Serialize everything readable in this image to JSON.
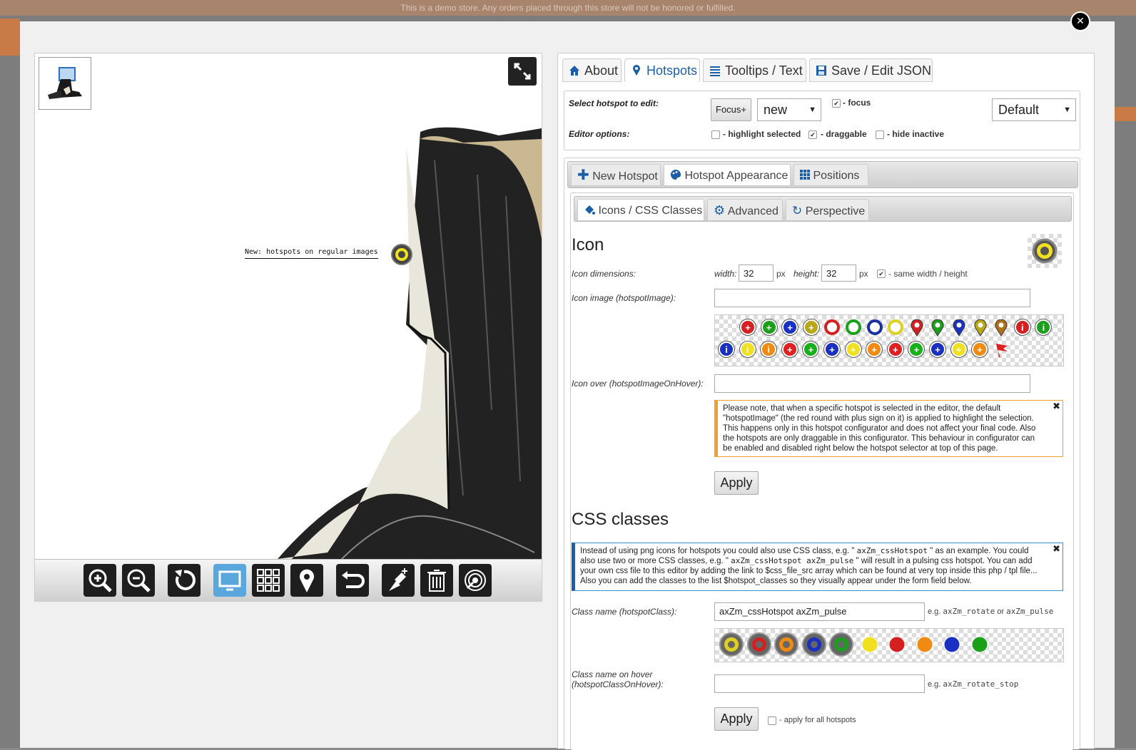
{
  "demo_banner": "This is a demo store. Any orders placed through this store will not be honored or fulfilled.",
  "close_symbol": "✕",
  "viewer": {
    "hotspot_label": "New: hotspots on regular images",
    "toolbar_icons": [
      "zoom-in-icon",
      "zoom-out-icon",
      "reset-icon",
      "fullscreen-screen-icon",
      "gallery-grid-icon",
      "hotspot-pin-icon",
      "undo-icon",
      "add-hotspot-icon",
      "trash-icon",
      "spin-icon"
    ]
  },
  "main_tabs": [
    {
      "label": "About",
      "icon": "home-icon"
    },
    {
      "label": "Hotspots",
      "icon": "map-marker-icon"
    },
    {
      "label": "Tooltips / Text",
      "icon": "list-icon"
    },
    {
      "label": "Save / Edit JSON",
      "icon": "save-icon"
    }
  ],
  "selector": {
    "select_label": "Select hotspot to edit:",
    "focus_button": "Focus+",
    "hotspot_select": "new",
    "focus_checkbox": "- focus",
    "preset_select": "Default",
    "options_label": "Editor options:",
    "highlight_selected": "- highlight selected",
    "draggable": "- draggable",
    "hide_inactive": "- hide inactive"
  },
  "sub_tabs": [
    {
      "label": "New Hotspot",
      "icon": "plus-icon"
    },
    {
      "label": "Hotspot Appearance",
      "icon": "palette-icon"
    },
    {
      "label": "Positions",
      "icon": "grid-icon"
    }
  ],
  "inner_tabs": [
    {
      "label": "Icons / CSS Classes",
      "icon": "paint-bucket-icon"
    },
    {
      "label": "Advanced",
      "icon": "cog-icon"
    },
    {
      "label": "Perspective",
      "icon": "refresh-icon"
    }
  ],
  "icon_section": {
    "heading": "Icon",
    "dimensions_label": "Icon dimensions:",
    "width_label": "width:",
    "width_value": "32",
    "height_label": "height:",
    "height_value": "32",
    "px": "px",
    "same_wh": "- same width / height",
    "image_label": "Icon image (hotspotImage):",
    "image_value": "",
    "over_label": "Icon over (hotspotImageOnHover):",
    "over_value": "",
    "note": "Please note, that when a specific hotspot is selected in the editor, the default \"hotspotImage\" (the red round with plus sign on it) is applied to highlight the selection. This happens only in this hotspot configurator and does not affect your final code. Also the hotspots are only draggable in this configurator. This behaviour in configurator can be enabled and disabled right below the hotspot selector at top of this page.",
    "note_close": "✖",
    "apply": "Apply",
    "icons_row1": [
      {
        "kind": "dot",
        "color": "#d42020",
        "glyph": "+"
      },
      {
        "kind": "dot",
        "color": "#1aa01a",
        "glyph": "+"
      },
      {
        "kind": "dot",
        "color": "#1a30c0",
        "glyph": "+"
      },
      {
        "kind": "dot",
        "color": "#b8a818",
        "glyph": "+"
      },
      {
        "kind": "ring",
        "color": "#d42020"
      },
      {
        "kind": "ring",
        "color": "#1aa01a"
      },
      {
        "kind": "ring",
        "color": "#1a30a0"
      },
      {
        "kind": "ring",
        "color": "#e0d020"
      },
      {
        "kind": "pin",
        "color": "#d42020"
      },
      {
        "kind": "pin",
        "color": "#1aa01a"
      },
      {
        "kind": "pin",
        "color": "#1a30c0"
      },
      {
        "kind": "pin",
        "color": "#b8a818"
      },
      {
        "kind": "pin",
        "color": "#b07018"
      },
      {
        "kind": "dot",
        "color": "#d42020",
        "glyph": "i"
      },
      {
        "kind": "dot",
        "color": "#1aa01a",
        "glyph": "i"
      }
    ],
    "icons_row2": [
      {
        "kind": "dot",
        "color": "#1a30c0",
        "glyph": "i"
      },
      {
        "kind": "dot",
        "color": "#f0e020",
        "glyph": "i"
      },
      {
        "kind": "dot",
        "color": "#f08a10",
        "glyph": "i"
      },
      {
        "kind": "dot",
        "color": "#e02020",
        "glyph": "+"
      },
      {
        "kind": "dot",
        "color": "#18b018",
        "glyph": "+"
      },
      {
        "kind": "dot",
        "color": "#1a30c0",
        "glyph": "+"
      },
      {
        "kind": "dot",
        "color": "#f0e020",
        "glyph": "+"
      },
      {
        "kind": "dot",
        "color": "#f08a10",
        "glyph": "+"
      },
      {
        "kind": "dot",
        "color": "#e02020",
        "glyph": "+"
      },
      {
        "kind": "dot",
        "color": "#18b018",
        "glyph": "+"
      },
      {
        "kind": "dot",
        "color": "#1a30c0",
        "glyph": "+"
      },
      {
        "kind": "dot",
        "color": "#f0e020",
        "glyph": "+"
      },
      {
        "kind": "dot",
        "color": "#f08a10",
        "glyph": "+"
      },
      {
        "kind": "flag",
        "color": "#e02020"
      }
    ]
  },
  "css_section": {
    "heading": "CSS classes",
    "note_parts": [
      "Instead of using png icons for hotspots you could also use CSS class, e.g. \" ",
      "axZm_cssHotspot",
      " \" as an example. You could also use two or more CSS classes, e.g. \" ",
      "axZm_cssHotspot axZm_pulse",
      " \" will result in a pulsing css hotspot. You can add your own css file to this editor by adding the link to $css_file_src array which can be found at very top inside this php / tpl file... Also you can add the classes to the list $hotspot_classes so they visually appear under the form field below."
    ],
    "note_close": "✖",
    "class_label": "Class name (hotspotClass):",
    "class_value": "axZm_cssHotspot axZm_pulse",
    "class_hint_pre": "e.g. ",
    "class_hint_a": "axZm_rotate",
    "class_hint_or": " or ",
    "class_hint_b": "axZm_pulse",
    "hover_label_1": "Class name on hover",
    "hover_label_2": "(hotspotClassOnHover):",
    "hover_value": "",
    "hover_hint_pre": "e.g. ",
    "hover_hint_a": "axZm_rotate_stop",
    "apply": "Apply",
    "apply_all": "- apply for all hotspots",
    "classes": [
      {
        "kind": "ring-grey",
        "color": "#e0d020"
      },
      {
        "kind": "ring-grey",
        "color": "#d42020"
      },
      {
        "kind": "ring-grey",
        "color": "#f08a10"
      },
      {
        "kind": "ring-grey",
        "color": "#1a30c0"
      },
      {
        "kind": "ring-grey",
        "color": "#1aa01a"
      },
      {
        "kind": "solid",
        "color": "#f0e020"
      },
      {
        "kind": "solid",
        "color": "#d42020"
      },
      {
        "kind": "solid",
        "color": "#f08a10"
      },
      {
        "kind": "solid",
        "color": "#1a30c0"
      },
      {
        "kind": "solid",
        "color": "#1aa01a"
      }
    ]
  }
}
